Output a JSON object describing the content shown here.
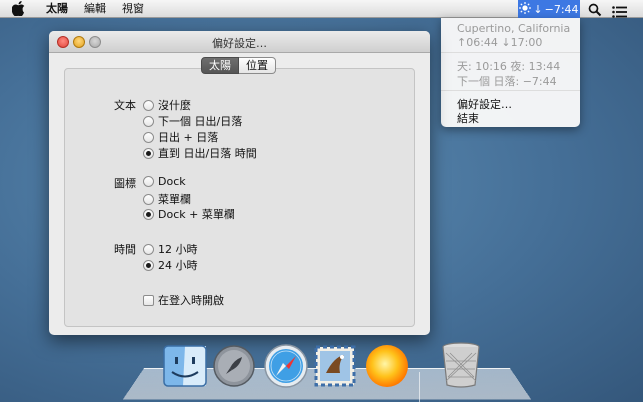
{
  "menubar": {
    "app_name": "太陽",
    "menus": [
      "編輯",
      "視窗"
    ],
    "status_time": "−7:44"
  },
  "dropdown": {
    "location": "Cupertino, California",
    "rise_set": "↑06:44   ↓17:00",
    "day_night": "天: 10:16   夜: 13:44",
    "next_event": "下一個 日落: −7:44",
    "preferences": "偏好設定…",
    "quit": "結束"
  },
  "window": {
    "title": "偏好設定…",
    "tabs": [
      "太陽",
      "位置"
    ],
    "text_label": "文本",
    "text_options": [
      "沒什麼",
      "下一個 日出/日落",
      "日出 + 日落",
      "直到 日出/日落 時間"
    ],
    "icon_label": "圖標",
    "icon_options": [
      "Dock",
      "菜單欄",
      "Dock + 菜單欄"
    ],
    "time_label": "時間",
    "time_options": [
      "12 小時",
      "24 小時"
    ],
    "login_checkbox": "在登入時開啟"
  }
}
